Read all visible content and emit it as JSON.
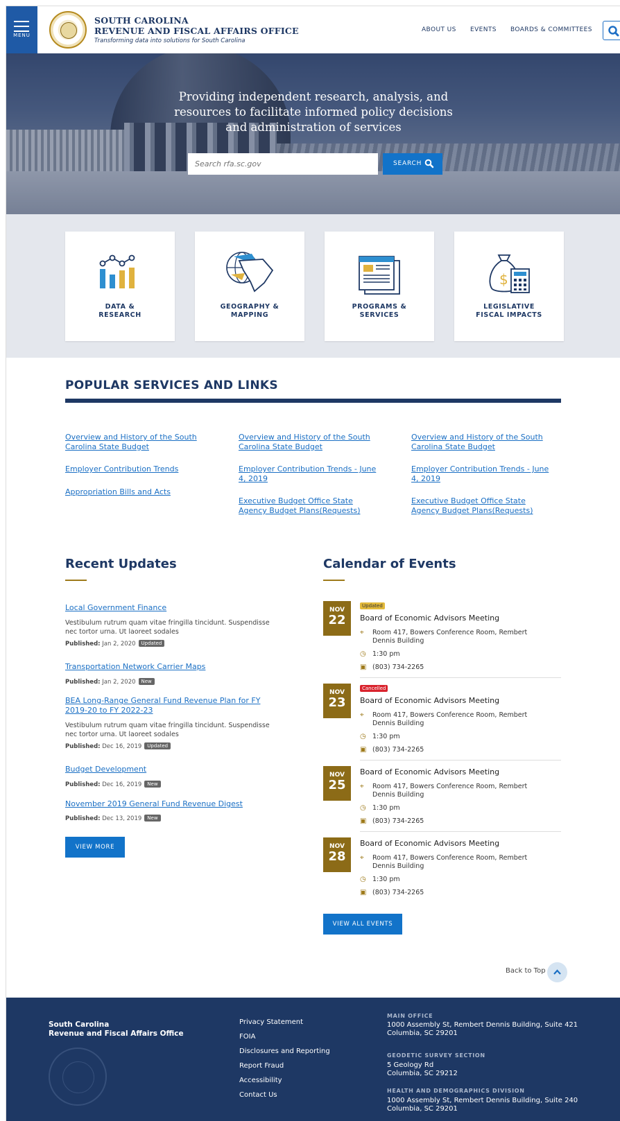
{
  "header": {
    "menu_label": "MENU",
    "org_line1": "SOUTH CAROLINA",
    "org_line2": "REVENUE AND FISCAL AFFAIRS OFFICE",
    "tagline": "Transforming data into solutions for South Carolina",
    "nav": [
      "ABOUT US",
      "EVENTS",
      "BOARDS & COMMITTEES"
    ]
  },
  "hero": {
    "headline": "Providing independent research, analysis, and resources to facilitate informed policy decisions and administration of services",
    "search_placeholder": "Search rfa.sc.gov",
    "search_button": "SEARCH"
  },
  "tiles": [
    {
      "line1": "DATA &",
      "line2": "RESEARCH",
      "icon": "bar-chart-icon"
    },
    {
      "line1": "GEOGRAPHY &",
      "line2": "MAPPING",
      "icon": "globe-map-icon"
    },
    {
      "line1": "PROGRAMS &",
      "line2": "SERVICES",
      "icon": "documents-icon"
    },
    {
      "line1": "LEGISLATIVE",
      "line2": "FISCAL IMPACTS",
      "icon": "money-bag-calculator-icon"
    }
  ],
  "popular": {
    "heading": "POPULAR SERVICES AND LINKS",
    "col1": [
      "Overview and History of the South Carolina State Budget",
      "Employer Contribution Trends",
      "Appropriation Bills and Acts"
    ],
    "col2": [
      "Overview and History of the South Carolina State Budget",
      "Employer Contribution Trends - June 4, 2019",
      "Executive Budget Office State Agency Budget Plans(Requests)"
    ],
    "col3": [
      "Overview and History of the South Carolina State Budget",
      "Employer Contribution Trends - June 4, 2019",
      "Executive Budget Office State Agency Budget Plans(Requests)"
    ]
  },
  "updates": {
    "heading": "Recent Updates",
    "published_label": "Published:",
    "items": [
      {
        "title": "Local Government Finance",
        "desc": "Vestibulum rutrum quam vitae fringilla tincidunt. Suspendisse nec tortor urna. Ut laoreet sodales",
        "date": "Jan 2, 2020",
        "badge": "Updated"
      },
      {
        "title": "Transportation Network Carrier Maps",
        "desc": "",
        "date": "Jan 2, 2020",
        "badge": "New"
      },
      {
        "title": "BEA Long-Range General Fund Revenue Plan for FY 2019-20 to FY 2022-23",
        "desc": "Vestibulum rutrum quam vitae fringilla tincidunt. Suspendisse nec tortor urna. Ut laoreet sodales",
        "date": "Dec 16, 2019",
        "badge": "Updated"
      },
      {
        "title": "Budget Development",
        "desc": "",
        "date": "Dec 16, 2019",
        "badge": "New"
      },
      {
        "title": "November 2019 General Fund Revenue Digest",
        "desc": "",
        "date": "Dec 13, 2019",
        "badge": "New"
      }
    ],
    "view_more": "VIEW MORE"
  },
  "calendar": {
    "heading": "Calendar of Events",
    "events": [
      {
        "month": "NOV",
        "day": "22",
        "badge": "Updated",
        "title": "Board of Economic Advisors Meeting",
        "location": "Room 417, Bowers Conference Room, Rembert Dennis Building",
        "time": "1:30 pm",
        "phone": "(803) 734-2265"
      },
      {
        "month": "NOV",
        "day": "23",
        "badge": "Cancelled",
        "title": "Board of Economic Advisors Meeting",
        "location": "Room 417, Bowers Conference Room, Rembert Dennis Building",
        "time": "1:30 pm",
        "phone": "(803) 734-2265"
      },
      {
        "month": "NOV",
        "day": "25",
        "badge": "",
        "title": "Board of Economic Advisors Meeting",
        "location": "Room 417, Bowers Conference Room, Rembert Dennis Building",
        "time": "1:30 pm",
        "phone": "(803) 734-2265"
      },
      {
        "month": "NOV",
        "day": "28",
        "badge": "",
        "title": "Board of Economic Advisors Meeting",
        "location": "Room 417, Bowers Conference Room, Rembert Dennis Building",
        "time": "1:30 pm",
        "phone": "(803) 734-2265"
      }
    ],
    "view_all": "VIEW ALL EVENTS"
  },
  "back_to_top": "Back to Top",
  "footer": {
    "org_line1": "South Carolina",
    "org_line2": "Revenue and Fiscal Affairs Office",
    "links": [
      "Privacy Statement",
      "FOIA",
      "Disclosures and Reporting",
      "Report Fraud",
      "Accessibility",
      "Contact Us"
    ],
    "offices": [
      {
        "label": "MAIN OFFICE",
        "line1": "1000 Assembly St, Rembert Dennis Building, Suite 421",
        "line2": "Columbia, SC 29201"
      },
      {
        "label": "GEODETIC SURVEY SECTION",
        "line1": "5 Geology Rd",
        "line2": "Columbia, SC 29212"
      },
      {
        "label": "HEALTH AND DEMOGRAPHICS DIVISION",
        "line1": "1000 Assembly St, Rembert Dennis Building, Suite 240",
        "line2": "Columbia, SC 29201"
      }
    ]
  },
  "colors": {
    "navy": "#1e3864",
    "blue": "#1273c9",
    "gold": "#8c6b17",
    "updated_badge": "#e2b93b",
    "cancelled_badge": "#d9232d"
  }
}
